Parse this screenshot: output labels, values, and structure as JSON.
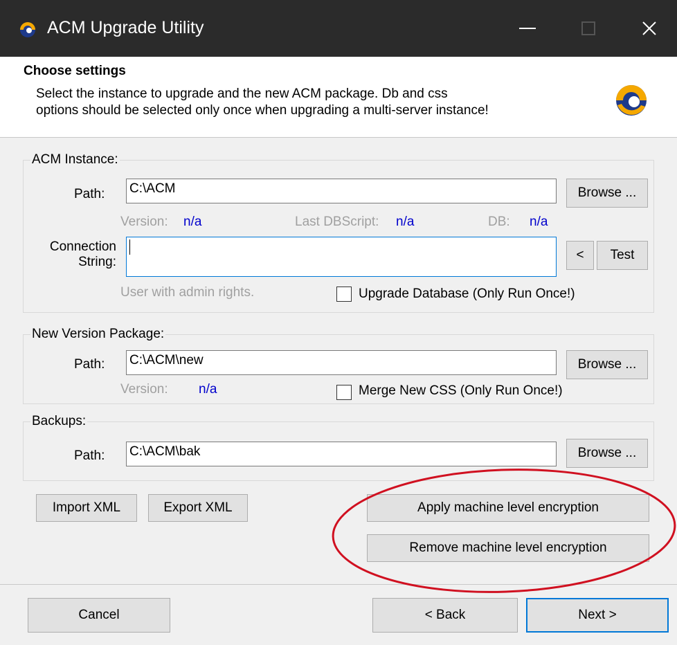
{
  "window": {
    "title": "ACM Upgrade Utility",
    "minimize_icon": "minimize-icon",
    "maximize_icon": "maximize-icon",
    "close_icon": "close-icon"
  },
  "header": {
    "title": "Choose settings",
    "description_line1": "Select the instance to upgrade and the new ACM package. Db and css",
    "description_line2": "options should be selected only once when upgrading a multi-server instance!",
    "logo_icon": "acm-logo-icon"
  },
  "acm_instance": {
    "legend": "ACM Instance:",
    "path_label": "Path:",
    "path_value": "C:\\ACM",
    "browse_label": "Browse ...",
    "version_label": "Version:",
    "version_value": "n/a",
    "last_dbscript_label": "Last DBScript:",
    "last_dbscript_value": "n/a",
    "db_label": "DB:",
    "db_value": "n/a",
    "connection_label_line1": "Connection",
    "connection_label_line2": "String:",
    "connection_value": "",
    "back_arrow_label": "<",
    "test_label": "Test",
    "hint": "User with admin rights.",
    "upgrade_db_label": "Upgrade Database (Only Run Once!)",
    "upgrade_db_checked": false
  },
  "new_version": {
    "legend": "New Version Package:",
    "path_label": "Path:",
    "path_value": "C:\\ACM\\new",
    "browse_label": "Browse ...",
    "version_label": "Version:",
    "version_value": "n/a",
    "merge_css_label": "Merge New CSS (Only Run Once!)",
    "merge_css_checked": false
  },
  "backups": {
    "legend": "Backups:",
    "path_label": "Path:",
    "path_value": "C:\\ACM\\bak",
    "browse_label": "Browse ..."
  },
  "actions": {
    "import_label": "Import XML",
    "export_label": "Export XML",
    "apply_encryption_label": "Apply machine level encryption",
    "remove_encryption_label": "Remove machine level encryption"
  },
  "footer": {
    "cancel_label": "Cancel",
    "back_label": "< Back",
    "next_label": "Next >"
  },
  "colors": {
    "titlebar": "#2b2b2b",
    "link_value": "#0000cc",
    "highlight_ellipse": "#d01020",
    "default_button_border": "#0078d7"
  }
}
